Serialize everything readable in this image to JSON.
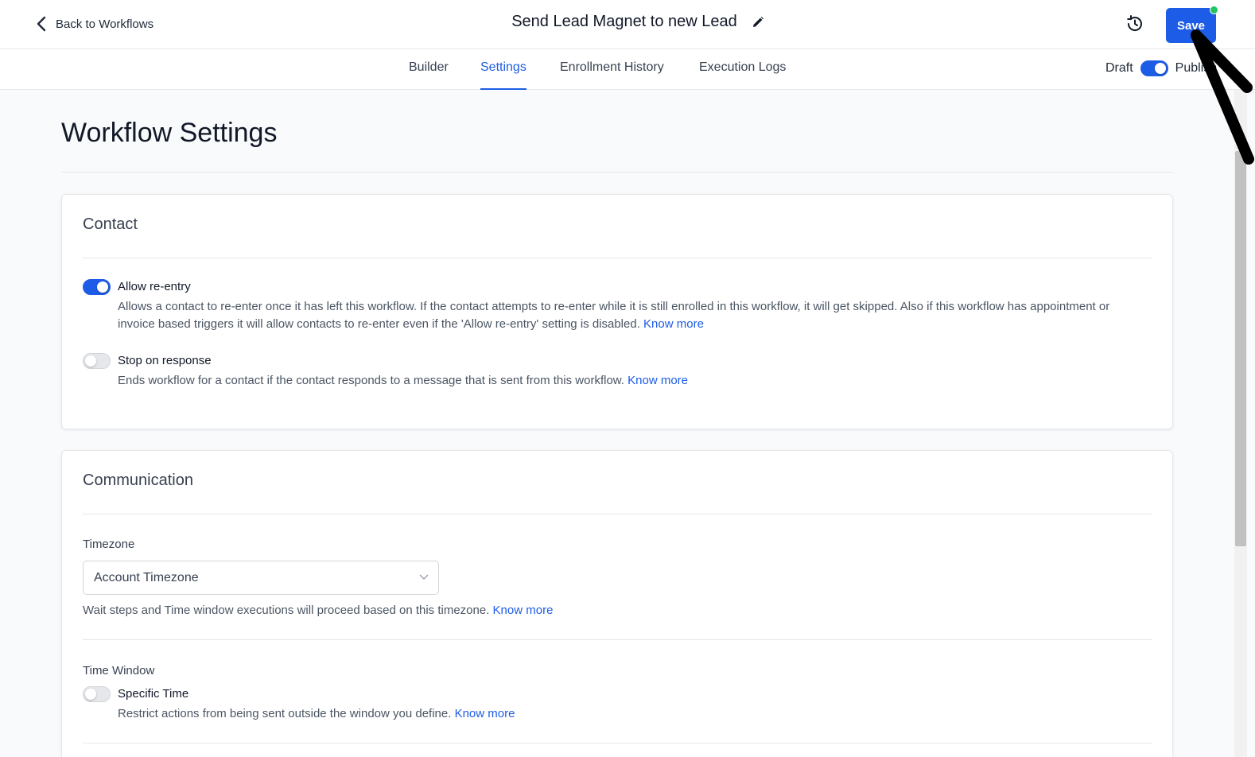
{
  "header": {
    "back_label": "Back to Workflows",
    "workflow_name": "Send Lead Magnet to new Lead",
    "save_label": "Save"
  },
  "tabs": [
    {
      "label": "Builder"
    },
    {
      "label": "Settings",
      "active": true
    },
    {
      "label": "Enrollment History"
    },
    {
      "label": "Execution Logs"
    }
  ],
  "status": {
    "draft_label": "Draft",
    "publish_label": "Publish",
    "published": true
  },
  "page": {
    "title": "Workflow Settings"
  },
  "contact": {
    "title": "Contact",
    "allow_reentry": {
      "label": "Allow re-entry",
      "enabled": true,
      "description": "Allows a contact to re-enter once it has left this workflow. If the contact attempts to re-enter while it is still enrolled in this workflow, it will get skipped. Also if this workflow has appointment or invoice based triggers it will allow contacts to re-enter even if the 'Allow re-entry' setting is disabled.",
      "link": "Know more"
    },
    "stop_on_response": {
      "label": "Stop on response",
      "enabled": false,
      "description": "Ends workflow for a contact if the contact responds to a message that is sent from this workflow.",
      "link": "Know more"
    }
  },
  "communication": {
    "title": "Communication",
    "timezone": {
      "label": "Timezone",
      "value": "Account Timezone",
      "help": "Wait steps and Time window executions will proceed based on this timezone.",
      "link": "Know more"
    },
    "time_window": {
      "label": "Time Window",
      "specific_time": {
        "label": "Specific Time",
        "enabled": false,
        "description": "Restrict actions from being sent outside the window you define.",
        "link": "Know more"
      }
    }
  },
  "colors": {
    "accent": "#1d5ce6",
    "save_indicator": "#22c55e"
  }
}
